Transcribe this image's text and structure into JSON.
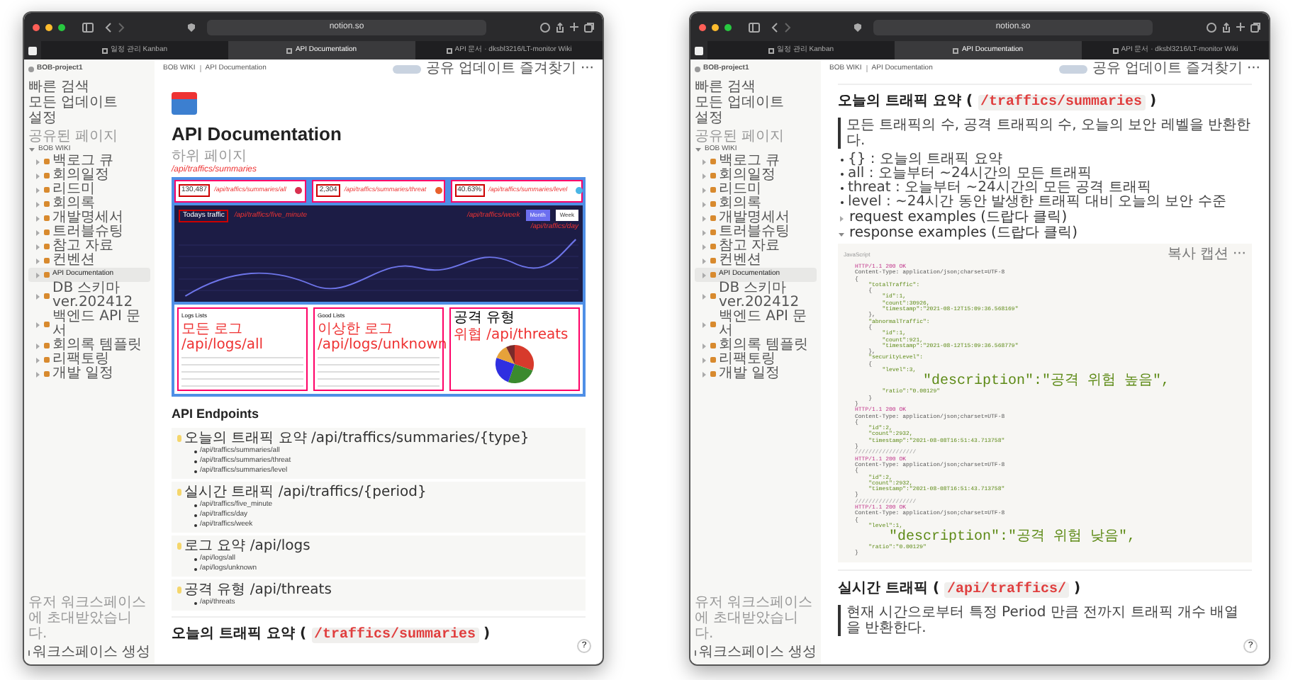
{
  "windows": [
    {
      "address": "notion.so",
      "tabs": [
        {
          "label": "일정 관리 Kanban",
          "selected": false
        },
        {
          "label": "API Documentation",
          "selected": true
        },
        {
          "label": "API 문서 · dksbl3216/LT-monitor Wiki",
          "selected": false
        }
      ],
      "workspace": "BOB-project1",
      "nav": [
        "빠른 검색",
        "모든 업데이트",
        "설정"
      ],
      "section": "공유된 페이지",
      "tree": [
        {
          "label": "BOB WIKI",
          "expanded": true,
          "children": [
            {
              "label": "백로그 큐",
              "selected": false,
              "expanded": false
            },
            {
              "label": "회의일정",
              "selected": false,
              "expanded": false
            },
            {
              "label": "리드미",
              "selected": false,
              "expanded": false
            },
            {
              "label": "회의록",
              "selected": false,
              "expanded": false
            },
            {
              "label": "개발명세서",
              "selected": false,
              "expanded": false
            },
            {
              "label": "트러블슈팅",
              "selected": false,
              "expanded": false
            },
            {
              "label": "참고 자료",
              "selected": false,
              "expanded": false
            },
            {
              "label": "컨벤션",
              "selected": false,
              "expanded": false
            },
            {
              "label": "API Documentation",
              "selected": true,
              "expanded": false
            },
            {
              "label": "DB 스키마 ver.202412",
              "selected": false,
              "expanded": false
            },
            {
              "label": "백엔드 API 문서",
              "selected": false,
              "expanded": false
            },
            {
              "label": "회의록 템플릿",
              "selected": false,
              "expanded": false
            },
            {
              "label": "리팩토링",
              "selected": false,
              "expanded": false
            },
            {
              "label": "개발 일정",
              "selected": false,
              "expanded": false
            }
          ]
        }
      ],
      "sidebar_note": "유저 워크스페이스에 초대받았습니다.",
      "new_workspace": "워크스페이스 생성",
      "breadcrumbs": [
        "BOB WIKI",
        "API Documentation"
      ],
      "actions": [
        "공유",
        "업데이트",
        "즐겨찾기",
        "···"
      ],
      "help": "?",
      "page": {
        "kind": "overview",
        "title": "API Documentation",
        "subtitle": "하위 페이지",
        "dashboard": {
          "annotation": "/api/traffics/summaries",
          "cards": [
            {
              "value": "130,487",
              "annotation": "/api/traffics/summaries/all",
              "color": "#d9304f"
            },
            {
              "value": "2,304",
              "annotation": "/api/traffics/summaries/threat",
              "color": "#e8602c"
            },
            {
              "value": "40.63%",
              "annotation": "/api/traffics/summaries/level",
              "color": "#49b6e6"
            }
          ],
          "chart": {
            "label": "Todays traffic",
            "annotation": "/api/traffics/five_minute",
            "buttons": [
              {
                "label": "Month",
                "selected": true
              },
              {
                "label": "Week",
                "selected": false
              }
            ],
            "button_annotations": [
              "/api/traffics/week",
              "/api/traffics/day"
            ]
          },
          "panels": [
            {
              "kind": "table",
              "title": "Logs Lists",
              "annotation": "모든 로그 /api/logs/all"
            },
            {
              "kind": "table",
              "title": "Good Lists",
              "annotation": "이상한 로그 /api/logs/unknown"
            },
            {
              "kind": "pie",
              "title": "공격 유형",
              "annotation": "위협 /api/threats"
            }
          ]
        },
        "endpoints_heading": "API Endpoints",
        "callouts": [
          {
            "title": "오늘의 트래픽 요약 /api/traffics/summaries/{type}",
            "items": [
              "/api/traffics/summaries/all",
              "/api/traffics/summaries/threat",
              "/api/traffics/summaries/level"
            ]
          },
          {
            "title": "실시간 트래픽 /api/traffics/{period}",
            "items": [
              "/api/traffics/five_minute",
              "/api/traffics/day",
              "/api/traffics/week"
            ]
          },
          {
            "title": "로그 요약 /api/logs",
            "items": [
              "/api/logs/all",
              "/api/logs/unknown"
            ]
          },
          {
            "title": "공격 유형 /api/threats",
            "items": [
              "/api/threats"
            ]
          }
        ],
        "next_heading": {
          "text": "오늘의 트래픽 요약 (",
          "code": "/traffics/summaries",
          "end": ")"
        }
      }
    },
    {
      "address": "notion.so",
      "tabs": [
        {
          "label": "일정 관리 Kanban",
          "selected": false
        },
        {
          "label": "API Documentation",
          "selected": true
        },
        {
          "label": "API 문서 · dksbl3216/LT-monitor Wiki",
          "selected": false
        }
      ],
      "workspace": "BOB-project1",
      "nav": [
        "빠른 검색",
        "모든 업데이트",
        "설정"
      ],
      "section": "공유된 페이지",
      "tree": [
        {
          "label": "BOB WIKI",
          "expanded": true,
          "children": [
            {
              "label": "백로그 큐",
              "selected": false,
              "expanded": false
            },
            {
              "label": "회의일정",
              "selected": false,
              "expanded": false
            },
            {
              "label": "리드미",
              "selected": false,
              "expanded": false
            },
            {
              "label": "회의록",
              "selected": false,
              "expanded": false
            },
            {
              "label": "개발명세서",
              "selected": false,
              "expanded": false
            },
            {
              "label": "트러블슈팅",
              "selected": false,
              "expanded": false
            },
            {
              "label": "참고 자료",
              "selected": false,
              "expanded": false
            },
            {
              "label": "컨벤션",
              "selected": false,
              "expanded": false
            },
            {
              "label": "API Documentation",
              "selected": true,
              "expanded": false
            },
            {
              "label": "DB 스키마 ver.202412",
              "selected": false,
              "expanded": false
            },
            {
              "label": "백엔드 API 문서",
              "selected": false,
              "expanded": false
            },
            {
              "label": "회의록 템플릿",
              "selected": false,
              "expanded": false
            },
            {
              "label": "리팩토링",
              "selected": false,
              "expanded": false
            },
            {
              "label": "개발 일정",
              "selected": false,
              "expanded": false
            }
          ]
        }
      ],
      "sidebar_note": "유저 워크스페이스에 초대받았습니다.",
      "new_workspace": "워크스페이스 생성",
      "breadcrumbs": [
        "BOB WIKI",
        "API Documentation"
      ],
      "actions": [
        "공유",
        "업데이트",
        "즐겨찾기",
        "···"
      ],
      "help": "?",
      "page": {
        "kind": "detail",
        "heading": {
          "text": "오늘의 트래픽 요약 (",
          "code": "/traffics/summaries",
          "end": ")"
        },
        "quote": "모든 트래픽의 수, 공격 트래픽의 수, 오늘의 보안 레벨을 반환한다.",
        "bullets": [
          "{} : 오늘의 트래픽 요약",
          "all : 오늘부터 ~24시간의 모든 트래픽",
          "threat : 오늘부터 ~24시간의 모든 공격 트래픽",
          "level : ~24시간 동안 발생한 트래픽 대비 오늘의 보안 수준"
        ],
        "toggles": [
          {
            "label": "request examples (드랍다 클릭)",
            "expanded": false
          },
          {
            "label": "response examples (드랍다 클릭)",
            "expanded": true
          }
        ],
        "code": {
          "language": "JavaScript",
          "tools": [
            "복사",
            "캡션",
            "···"
          ],
          "lines": [
            {
              "kind": "http",
              "text": "HTTP/1.1 200 OK"
            },
            {
              "kind": "header",
              "text": "Content-Type: application/json;charset=UTF-8"
            },
            {
              "kind": "brace",
              "text": "{"
            },
            {
              "kind": "json",
              "text": "    \"totalTraffic\":"
            },
            {
              "kind": "brace",
              "text": "    {"
            },
            {
              "kind": "json",
              "text": "        \"id\":1,"
            },
            {
              "kind": "json",
              "text": "        \"count\":30926,"
            },
            {
              "kind": "json",
              "text": "        \"timestamp\":\"2021-08-12T15:09:36.568169\""
            },
            {
              "kind": "brace",
              "text": "    },"
            },
            {
              "kind": "json",
              "text": "    \"abnormalTraffic\":"
            },
            {
              "kind": "brace",
              "text": "    {"
            },
            {
              "kind": "json",
              "text": "        \"id\":1,"
            },
            {
              "kind": "json",
              "text": "        \"count\":921,"
            },
            {
              "kind": "json",
              "text": "        \"timestamp\":\"2021-08-12T15:09:36.568779\""
            },
            {
              "kind": "brace",
              "text": "    },"
            },
            {
              "kind": "json",
              "text": "    \"securityLevel\":"
            },
            {
              "kind": "brace",
              "text": "    {"
            },
            {
              "kind": "json",
              "text": "        \"level\":3,"
            },
            {
              "kind": "json",
              "text": "        \"description\":\"공격 위험 높음\","
            },
            {
              "kind": "json",
              "text": "        \"ratio\":\"0.00129\""
            },
            {
              "kind": "brace",
              "text": "    }"
            },
            {
              "kind": "brace",
              "text": "}"
            },
            {
              "kind": "http",
              "text": "HTTP/1.1 200 OK"
            },
            {
              "kind": "header",
              "text": "Content-Type: application/json;charset=UTF-8"
            },
            {
              "kind": "brace",
              "text": "{"
            },
            {
              "kind": "json",
              "text": "    \"id\":2,"
            },
            {
              "kind": "json",
              "text": "    \"count\":2932,"
            },
            {
              "kind": "json",
              "text": "    \"timestamp\":\"2021-08-08T16:51:43.713758\""
            },
            {
              "kind": "brace",
              "text": "}"
            },
            {
              "kind": "comment",
              "text": "//////////////////"
            },
            {
              "kind": "http",
              "text": "HTTP/1.1 200 OK"
            },
            {
              "kind": "header",
              "text": "Content-Type: application/json;charset=UTF-8"
            },
            {
              "kind": "brace",
              "text": "{"
            },
            {
              "kind": "json",
              "text": "    \"id\":2,"
            },
            {
              "kind": "json",
              "text": "    \"count\":2932,"
            },
            {
              "kind": "json",
              "text": "    \"timestamp\":\"2021-08-08T16:51:43.713758\""
            },
            {
              "kind": "brace",
              "text": "}"
            },
            {
              "kind": "comment",
              "text": "//////////////////"
            },
            {
              "kind": "http",
              "text": "HTTP/1.1 200 OK"
            },
            {
              "kind": "header",
              "text": "Content-Type: application/json;charset=UTF-8"
            },
            {
              "kind": "brace",
              "text": "{"
            },
            {
              "kind": "json",
              "text": "    \"level\":1,"
            },
            {
              "kind": "json",
              "text": "    \"description\":\"공격 위험 낮음\","
            },
            {
              "kind": "json",
              "text": "    \"ratio\":\"0.00129\""
            },
            {
              "kind": "brace",
              "text": "}"
            }
          ]
        },
        "next_heading": {
          "text": "실시간 트래픽 (",
          "code": "/api/traffics/",
          "end": ")"
        },
        "next_quote": "현재 시간으로부터 특정 Period 만큼 전까지 트래픽 개수 배열을 반환한다."
      }
    }
  ]
}
